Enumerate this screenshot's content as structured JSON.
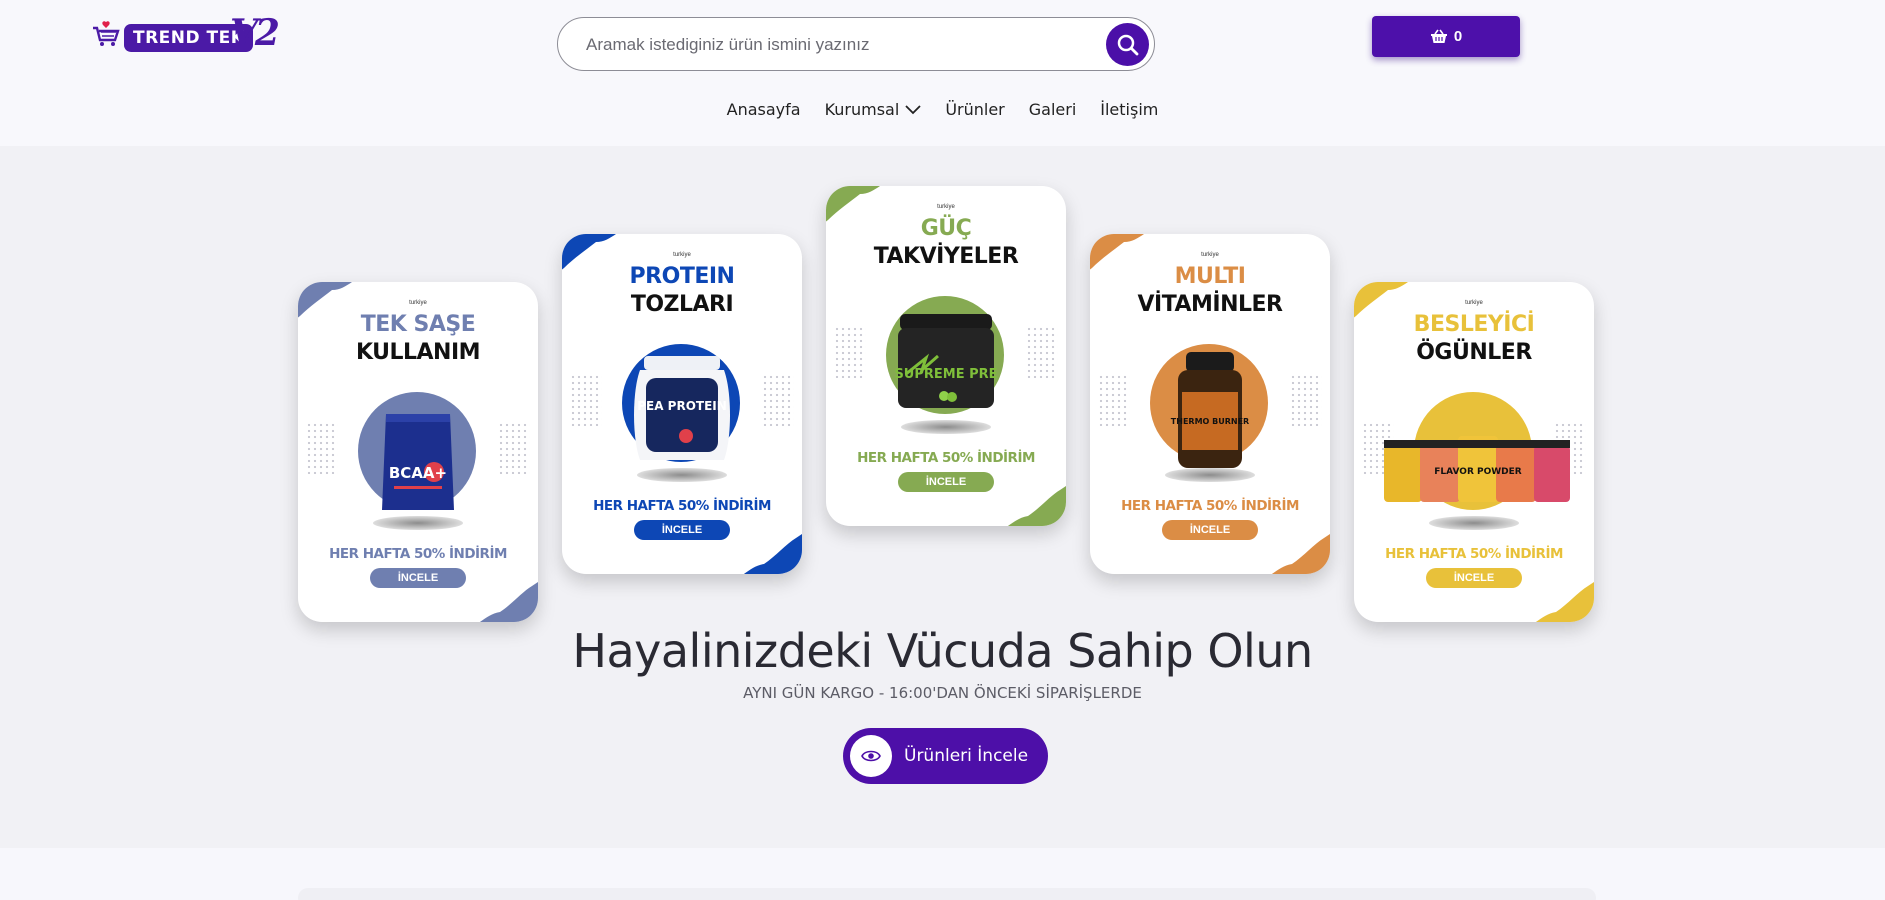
{
  "header": {
    "logo_text": "TREND TEK",
    "logo_version": "V2",
    "search_placeholder": "Aramak istediginiz ürün ismini yazınız",
    "cart_count": "0"
  },
  "nav": [
    {
      "label": "Anasayfa"
    },
    {
      "label": "Kurumsal",
      "has_dropdown": true
    },
    {
      "label": "Ürünler"
    },
    {
      "label": "Galeri"
    },
    {
      "label": "İletişim"
    }
  ],
  "cards": [
    {
      "brand": "turkiye",
      "title1": "TEK SAŞE",
      "title2": "KULLANIM",
      "product": "BCAA+",
      "deal": "HER HAFTA 50% İNDİRİM",
      "button": "İNCELE",
      "color": "#6f7fb0"
    },
    {
      "brand": "turkiye",
      "title1": "PROTEIN",
      "title2": "TOZLARI",
      "product": "PEA PROTEIN",
      "deal": "HER HAFTA 50% İNDİRİM",
      "button": "İNCELE",
      "color": "#0d47b5"
    },
    {
      "brand": "turkiye",
      "title1": "GÜÇ",
      "title2": "TAKVİYELER",
      "product": "SUPREME PRE",
      "deal": "HER HAFTA 50% İNDİRİM",
      "button": "İNCELE",
      "color": "#86aa52"
    },
    {
      "brand": "turkiye",
      "title1": "MULTI",
      "title2": "VİTAMİNLER",
      "product": "THERMO BURNER",
      "deal": "HER HAFTA 50% İNDİRİM",
      "button": "İNCELE",
      "color": "#db8d45"
    },
    {
      "brand": "turkiye",
      "title1": "BESLEYİCİ",
      "title2": "ÖGÜNLER",
      "product": "FLAVOR POWDER",
      "deal": "HER HAFTA 50% İNDİRİM",
      "button": "İNCELE",
      "color": "#e8c13a"
    }
  ],
  "hero": {
    "title": "Hayalinizdeki Vücuda Sahip Olun",
    "subtitle": "AYNI GÜN KARGO - 16:00'DAN ÖNCEKİ SİPARİŞLERDE",
    "cta": "Ürünleri İncele"
  },
  "icons": {
    "search": "search-icon",
    "cart": "basket-icon",
    "cta": "eye-icon",
    "dropdown": "chevron-down-icon"
  },
  "colors": {
    "brand": "#4b0fa8"
  }
}
